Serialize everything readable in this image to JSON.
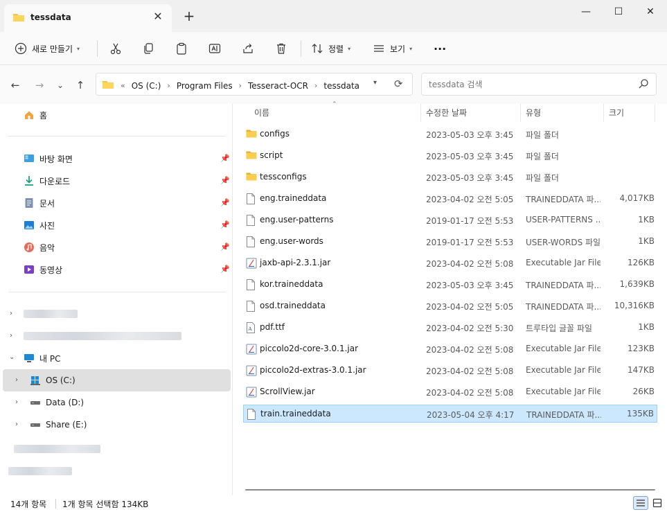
{
  "window": {
    "tab_title": "tessdata",
    "tab_close": "✕",
    "new_tab": "+",
    "minimize": "—",
    "maximize": "☐",
    "close": "✕"
  },
  "toolbar": {
    "new_label": "새로 만들기",
    "sort_label": "정렬",
    "view_label": "보기",
    "more_label": "···"
  },
  "nav": {
    "back": "←",
    "forward": "→",
    "recent": "⌄",
    "up": "↑"
  },
  "address": {
    "overflow": "«",
    "crumbs": [
      "OS (C:)",
      "Program Files",
      "Tesseract-OCR",
      "tessdata"
    ],
    "separator": "›"
  },
  "search": {
    "placeholder": "tessdata 검색"
  },
  "sidebar": {
    "home": "홈",
    "quick": [
      {
        "label": "바탕 화면",
        "icon": "desktop-icon"
      },
      {
        "label": "다운로드",
        "icon": "download-icon"
      },
      {
        "label": "문서",
        "icon": "documents-icon"
      },
      {
        "label": "사진",
        "icon": "pictures-icon"
      },
      {
        "label": "음악",
        "icon": "music-icon"
      },
      {
        "label": "동영상",
        "icon": "videos-icon"
      }
    ],
    "this_pc": "내 PC",
    "drives": [
      "OS (C:)",
      "Data (D:)",
      "Share (E:)"
    ]
  },
  "columns": {
    "name": "이름",
    "date": "수정한 날짜",
    "type": "유형",
    "size": "크기"
  },
  "files": [
    {
      "name": "configs",
      "date": "2023-05-03 오후 3:45",
      "type": "파일 폴더",
      "size": "",
      "icon": "folder"
    },
    {
      "name": "script",
      "date": "2023-05-03 오후 3:45",
      "type": "파일 폴더",
      "size": "",
      "icon": "folder"
    },
    {
      "name": "tessconfigs",
      "date": "2023-05-03 오후 3:45",
      "type": "파일 폴더",
      "size": "",
      "icon": "folder"
    },
    {
      "name": "eng.traineddata",
      "date": "2023-04-02 오전 5:05",
      "type": "TRAINEDDATA 파...",
      "size": "4,017KB",
      "icon": "file"
    },
    {
      "name": "eng.user-patterns",
      "date": "2019-01-17 오전 5:53",
      "type": "USER-PATTERNS ...",
      "size": "1KB",
      "icon": "file"
    },
    {
      "name": "eng.user-words",
      "date": "2019-01-17 오전 5:53",
      "type": "USER-WORDS 파일",
      "size": "1KB",
      "icon": "file"
    },
    {
      "name": "jaxb-api-2.3.1.jar",
      "date": "2023-04-02 오전 5:08",
      "type": "Executable Jar File",
      "size": "126KB",
      "icon": "jar"
    },
    {
      "name": "kor.traineddata",
      "date": "2023-05-03 오후 3:45",
      "type": "TRAINEDDATA 파...",
      "size": "1,639KB",
      "icon": "file"
    },
    {
      "name": "osd.traineddata",
      "date": "2023-04-02 오전 5:05",
      "type": "TRAINEDDATA 파...",
      "size": "10,316KB",
      "icon": "file"
    },
    {
      "name": "pdf.ttf",
      "date": "2023-04-02 오전 5:30",
      "type": "트루타입 글꼴 파일",
      "size": "1KB",
      "icon": "font"
    },
    {
      "name": "piccolo2d-core-3.0.1.jar",
      "date": "2023-04-02 오전 5:08",
      "type": "Executable Jar File",
      "size": "123KB",
      "icon": "jar"
    },
    {
      "name": "piccolo2d-extras-3.0.1.jar",
      "date": "2023-04-02 오전 5:08",
      "type": "Executable Jar File",
      "size": "147KB",
      "icon": "jar"
    },
    {
      "name": "ScrollView.jar",
      "date": "2023-04-02 오전 5:08",
      "type": "Executable Jar File",
      "size": "26KB",
      "icon": "jar"
    },
    {
      "name": "train.traineddata",
      "date": "2023-05-04 오후 4:17",
      "type": "TRAINEDDATA 파...",
      "size": "135KB",
      "icon": "file",
      "selected": true
    }
  ],
  "status": {
    "count": "14개 항목",
    "selection": "1개 항목 선택함 134KB"
  },
  "colors": {
    "folder": "#f4c542",
    "selected_row": "#cce8ff",
    "accent": "#0067c0"
  }
}
